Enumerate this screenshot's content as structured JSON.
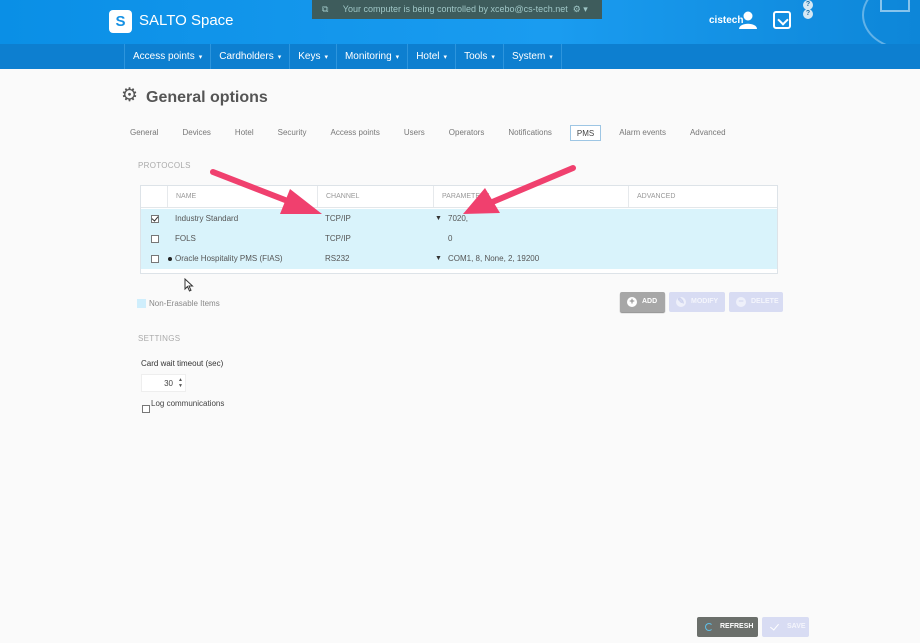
{
  "app": {
    "brand": "SALTO Space",
    "logo_letter": "S"
  },
  "remote_banner": {
    "text": "Your computer is being controlled by xcebo@cs-tech.net",
    "icon": "remote-desktop-icon"
  },
  "user": {
    "name": "cistech"
  },
  "menu": [
    {
      "label": "Access points",
      "caret": "▾"
    },
    {
      "label": "Cardholders",
      "caret": "▾"
    },
    {
      "label": "Keys",
      "caret": "▾"
    },
    {
      "label": "Monitoring",
      "caret": "▾"
    },
    {
      "label": "Hotel",
      "caret": "▾"
    },
    {
      "label": "Tools",
      "caret": "▾"
    },
    {
      "label": "System",
      "caret": "▾"
    }
  ],
  "page": {
    "title": "General options"
  },
  "tabs": [
    {
      "label": "General"
    },
    {
      "label": "Devices"
    },
    {
      "label": "Hotel"
    },
    {
      "label": "Security"
    },
    {
      "label": "Access points"
    },
    {
      "label": "Users"
    },
    {
      "label": "Operators"
    },
    {
      "label": "Notifications"
    },
    {
      "label": "PMS",
      "active": true
    },
    {
      "label": "Alarm events"
    },
    {
      "label": "Advanced"
    }
  ],
  "protocols": {
    "section_label": "PROTOCOLS",
    "columns": [
      "NAME",
      "CHANNEL",
      "PARAMETERS",
      "ADVANCED"
    ],
    "rows": [
      {
        "checked": true,
        "dot": false,
        "name": "Industry Standard",
        "channel": "TCP/IP",
        "has_dropdown": true,
        "parameters": "7020,"
      },
      {
        "checked": false,
        "dot": false,
        "name": "FOLS",
        "channel": "TCP/IP",
        "has_dropdown": false,
        "parameters": "0"
      },
      {
        "checked": false,
        "dot": true,
        "name": "Oracle Hospitality PMS (FIAS)",
        "channel": "RS232",
        "has_dropdown": true,
        "parameters": "COM1, 8, None, 2, 19200"
      }
    ],
    "legend": "Non-Erasable Items"
  },
  "actions": {
    "add": "ADD",
    "modify": "MODIFY",
    "delete": "DELETE"
  },
  "settings": {
    "section_label": "SETTINGS",
    "card_wait_label": "Card wait timeout (sec)",
    "card_wait_value": "30",
    "log_label": "Log communications",
    "log_checked": false
  },
  "footer": {
    "refresh": "REFRESH",
    "save": "SAVE"
  },
  "colors": {
    "topbar": "#1a9cf0",
    "menubar": "#0d7fd0",
    "row_highlight": "#d9f3fb",
    "arrow": "#f0406e"
  }
}
